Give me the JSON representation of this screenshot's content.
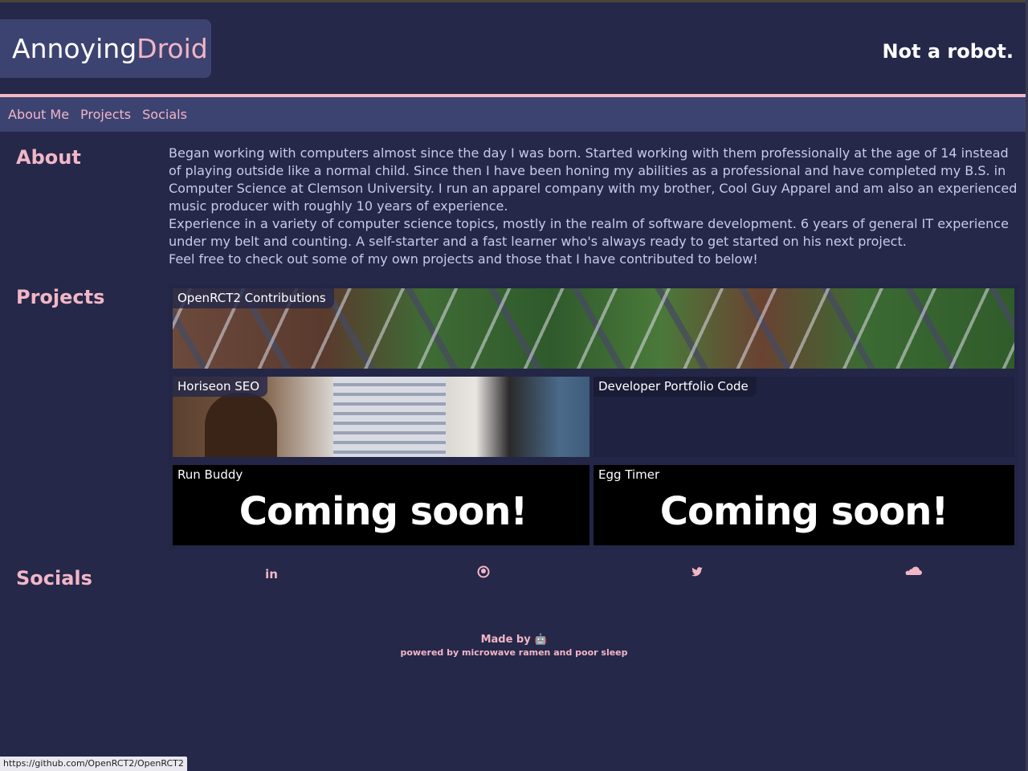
{
  "header": {
    "logo_part1": "Annoying",
    "logo_part2": "Droid",
    "tagline": "Not a robot."
  },
  "nav": {
    "items": [
      {
        "label": "About Me"
      },
      {
        "label": "Projects"
      },
      {
        "label": "Socials"
      }
    ]
  },
  "about": {
    "title": "About",
    "paragraphs": [
      "Began working with computers almost since the day I was born. Started working with them professionally at the age of 14 instead of playing outside like a normal child. Since then I have been honing my abilities as a professional and have completed my B.S. in Computer Science at Clemson University. I run an apparel company with my brother, Cool Guy Apparel and am also an experienced music producer with roughly 10 years of experience.",
      "Experience in a variety of computer science topics, mostly in the realm of software development. 6 years of general IT experience under my belt and counting. A self-starter and a fast learner who's always ready to get started on his next project.",
      "Feel free to check out some of my own projects and those that I have contributed to below!"
    ]
  },
  "projects": {
    "title": "Projects",
    "items": [
      {
        "label": "OpenRCT2 Contributions"
      },
      {
        "label": "Horiseon SEO"
      },
      {
        "label": "Developer Portfolio Code"
      },
      {
        "label": "Run Buddy",
        "overlay": "Coming soon!"
      },
      {
        "label": "Egg Timer",
        "overlay": "Coming soon!"
      }
    ]
  },
  "socials": {
    "title": "Socials",
    "icons": [
      {
        "name": "linkedin-icon",
        "glyph": "in"
      },
      {
        "name": "github-icon",
        "glyph": "◉"
      },
      {
        "name": "twitter-icon",
        "glyph": "🐦"
      },
      {
        "name": "soundcloud-icon",
        "glyph": "☁"
      }
    ]
  },
  "footer": {
    "made_by": "Made by",
    "emoji": "🤖",
    "powered_by": "powered by microwave ramen and poor sleep"
  },
  "statusbar": {
    "url": "https://github.com/OpenRCT2/OpenRCT2"
  },
  "colors": {
    "background": "#252849",
    "accent_pink": "#f2b6c6",
    "panel": "#3d4371"
  }
}
